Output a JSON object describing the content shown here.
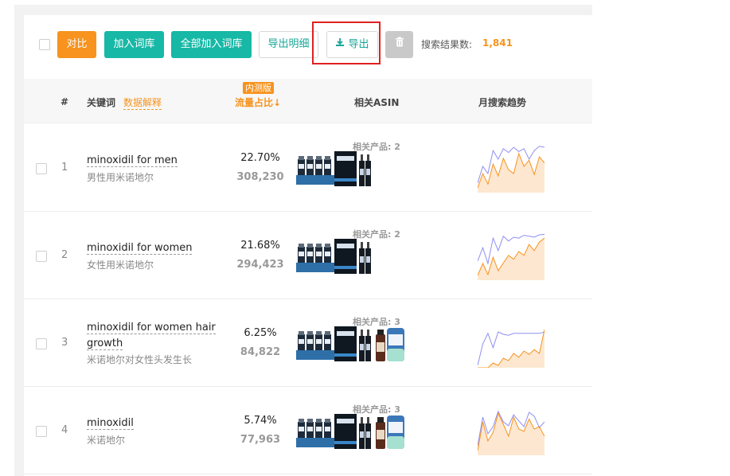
{
  "toolbar": {
    "compare": "对比",
    "add_to_lib": "加入词库",
    "add_all_to_lib": "全部加入词库",
    "export_detail": "导出明细",
    "export": "导出",
    "result_label": "搜索结果数:",
    "result_count": "1,841"
  },
  "header": {
    "num": "#",
    "keyword": "关键词",
    "data_explain": "数据解释",
    "beta": "内测版",
    "traffic_share": "流量占比↓",
    "related_asin": "相关ASIN",
    "monthly_trend": "月搜索趋势"
  },
  "colors": {
    "orange": "#f7931e",
    "teal": "#17b8a6",
    "highlight": "#e02020",
    "trend_blue": "#8f8ff0",
    "trend_orange": "#f7931e"
  },
  "rows": [
    {
      "num": "1",
      "kw_en": "minoxidil for men",
      "kw_cn": "男性用米诺地尔",
      "pct": "22.70%",
      "count": "308,230",
      "rel": "相关产品: 2",
      "trend_a": [
        20,
        55,
        40,
        88,
        70,
        92,
        84,
        95,
        86,
        92,
        70,
        88,
        97,
        95
      ],
      "trend_b": [
        10,
        40,
        18,
        60,
        35,
        72,
        48,
        40,
        82,
        55,
        68,
        38,
        75,
        62
      ]
    },
    {
      "num": "2",
      "kw_en": "minoxidil for women",
      "kw_cn": "女性用米诺地尔",
      "pct": "21.68%",
      "count": "294,423",
      "rel": "相关产品: 2",
      "trend_a": [
        40,
        68,
        35,
        88,
        62,
        92,
        82,
        90,
        88,
        94,
        92,
        90,
        95,
        96
      ],
      "trend_b": [
        10,
        35,
        12,
        48,
        20,
        36,
        52,
        44,
        60,
        52,
        75,
        62,
        80,
        88
      ]
    },
    {
      "num": "3",
      "kw_en": "minoxidil for women hair growth",
      "kw_cn": "米诺地尔对女性头发生长",
      "pct": "6.25%",
      "count": "84,822",
      "rel": "相关产品: 3",
      "trend_a": [
        5,
        50,
        72,
        42,
        75,
        70,
        68,
        72,
        72,
        72,
        72,
        72,
        72,
        75
      ],
      "trend_b": [
        0,
        0,
        0,
        10,
        5,
        20,
        15,
        30,
        22,
        35,
        28,
        38,
        30,
        80
      ]
    },
    {
      "num": "4",
      "kw_en": "minoxidil",
      "kw_cn": "米诺地尔",
      "pct": "5.74%",
      "count": "77,963",
      "rel": "相关产品: 3",
      "trend_a": [
        20,
        80,
        45,
        60,
        92,
        70,
        62,
        85,
        72,
        60,
        90,
        82,
        58,
        70
      ],
      "trend_b": [
        10,
        70,
        30,
        48,
        88,
        65,
        40,
        80,
        55,
        50,
        76,
        55,
        60,
        40
      ]
    }
  ]
}
